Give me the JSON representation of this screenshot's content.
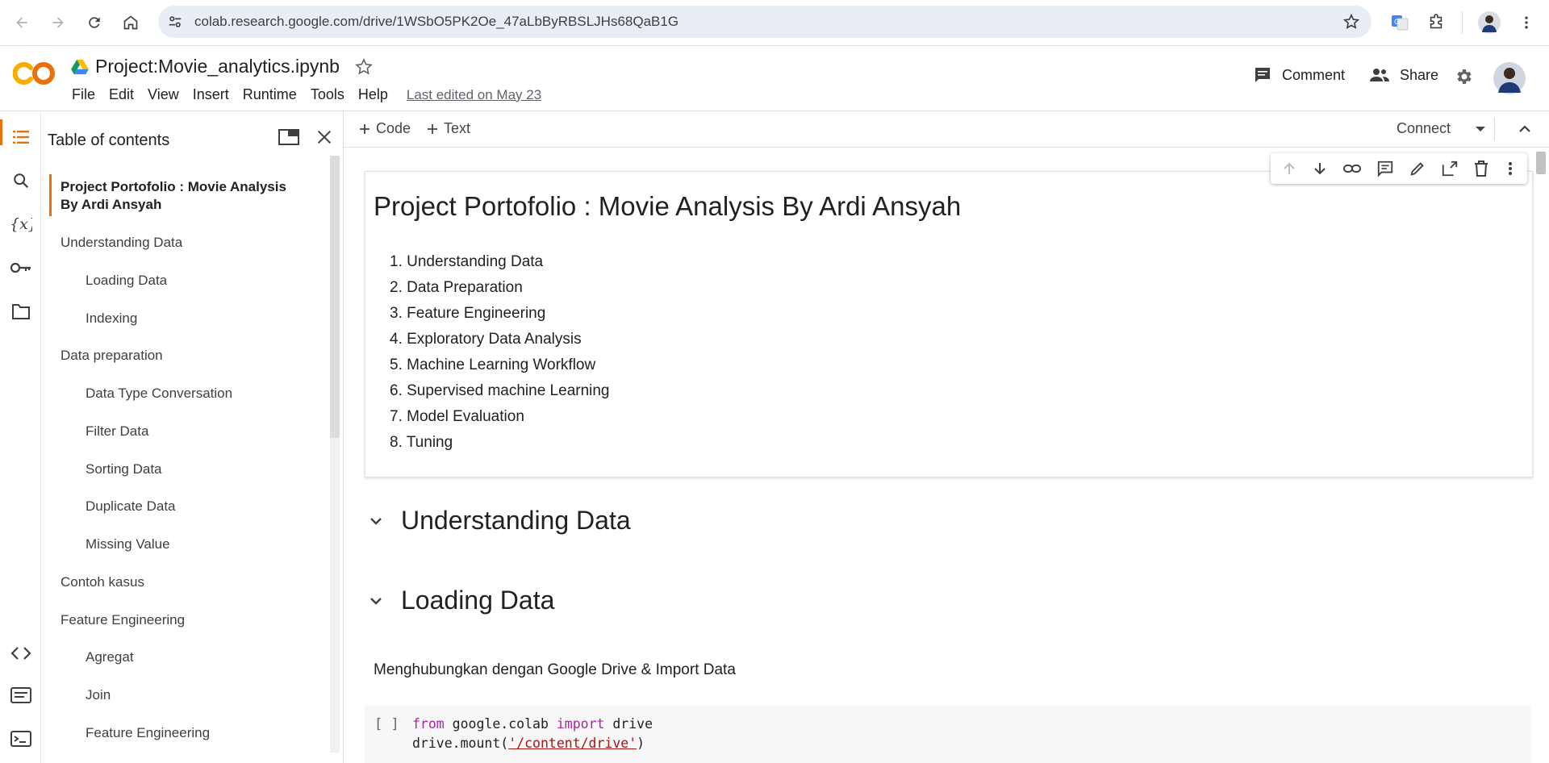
{
  "browser": {
    "url": "colab.research.google.com/drive/1WSbO5PK2Oe_47aLbByRBSLJHs68QaB1G"
  },
  "header": {
    "notebook_title": "Project:Movie_analytics.ipynb",
    "menus": [
      "File",
      "Edit",
      "View",
      "Insert",
      "Runtime",
      "Tools",
      "Help"
    ],
    "last_edited": "Last edited on May 23",
    "comment_label": "Comment",
    "share_label": "Share"
  },
  "toolbar": {
    "add_code": "Code",
    "add_text": "Text",
    "connect": "Connect"
  },
  "toc": {
    "title": "Table of contents",
    "active": "Project Portofolio : Movie Analysis By Ardi Ansyah",
    "items": [
      {
        "label": "Understanding Data",
        "level": 1
      },
      {
        "label": "Loading Data",
        "level": 2
      },
      {
        "label": "Indexing",
        "level": 2
      },
      {
        "label": "Data preparation",
        "level": 1
      },
      {
        "label": "Data Type Conversation",
        "level": 2
      },
      {
        "label": "Filter Data",
        "level": 2
      },
      {
        "label": "Sorting Data",
        "level": 2
      },
      {
        "label": "Duplicate Data",
        "level": 2
      },
      {
        "label": "Missing Value",
        "level": 2
      },
      {
        "label": "Contoh kasus",
        "level": 1
      },
      {
        "label": "Feature Engineering",
        "level": 1
      },
      {
        "label": "Agregat",
        "level": 2
      },
      {
        "label": "Join",
        "level": 2
      },
      {
        "label": "Feature Engineering",
        "level": 2
      }
    ]
  },
  "notebook": {
    "heading": "Project Portofolio : Movie Analysis By Ardi Ansyah",
    "list": [
      "1. Understanding Data",
      "2. Data Preparation",
      "3. Feature Engineering",
      "4. Exploratory Data Analysis",
      "5. Machine Learning Workflow",
      "6. Supervised machine Learning",
      "7. Model Evaluation",
      "8. Tuning"
    ],
    "section1": "Understanding Data",
    "section2": "Loading Data",
    "markdown": "Menghubungkan dengan Google Drive & Import Data",
    "exec_count": "[ ]",
    "code": {
      "l1_a": "from",
      "l1_b": " google.colab ",
      "l1_c": "import",
      "l1_d": " drive",
      "l2_a": "drive.mount(",
      "l2_b": "'/content/drive'",
      "l2_c": ")"
    }
  },
  "colors": {
    "accent": "#e8710a",
    "keyword": "#a626a4",
    "string": "#a31515"
  }
}
